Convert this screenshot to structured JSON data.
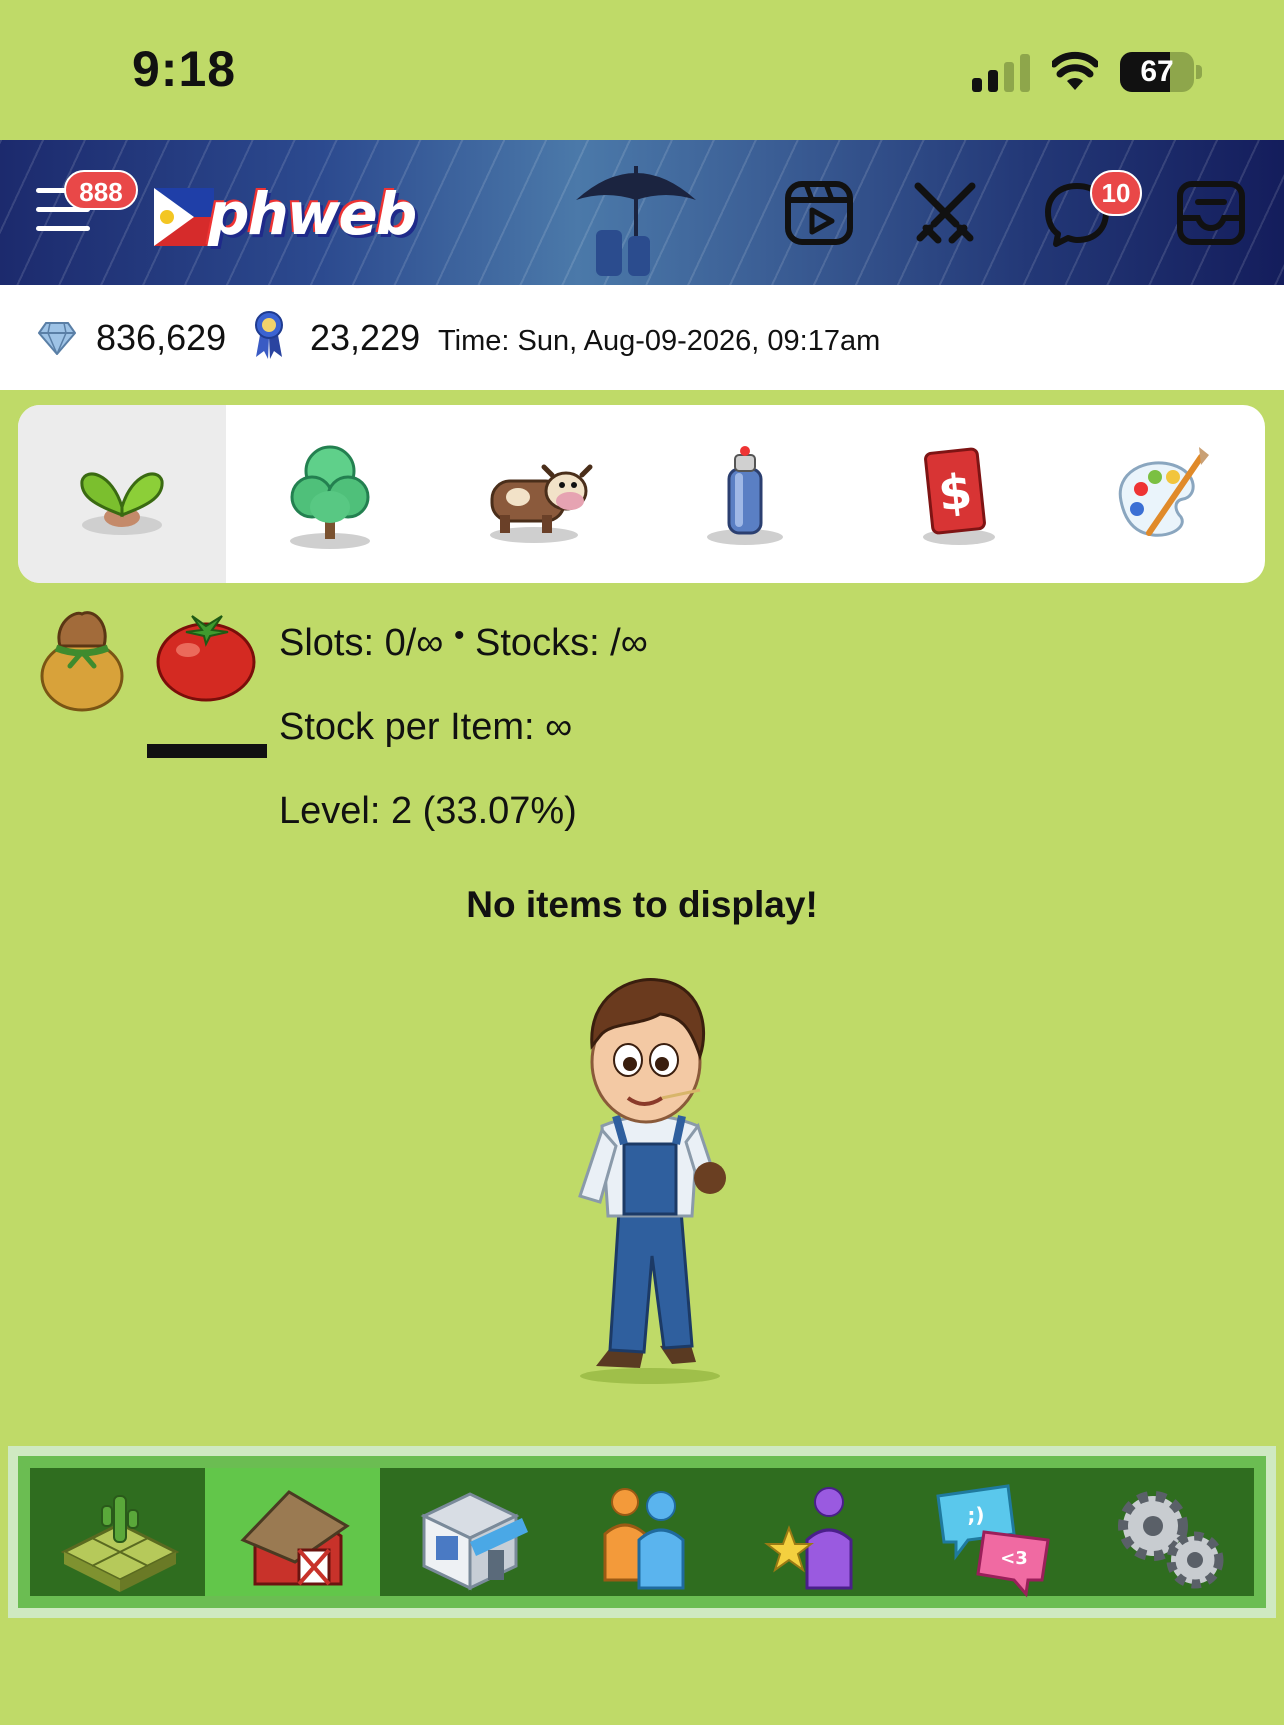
{
  "status_bar": {
    "time": "9:18",
    "battery": "67",
    "battery_level": 0.67,
    "icons": [
      "signal-icon",
      "wifi-icon",
      "battery-icon"
    ]
  },
  "header": {
    "menu_badge": "888",
    "logo_text": "phweb",
    "icons": [
      "menu-icon",
      "video-icon",
      "battle-icon",
      "chat-icon",
      "inbox-icon"
    ],
    "chat_badge": "10"
  },
  "currency": {
    "gems": "836,629",
    "ribbons": "23,229",
    "time_label": "Time: Sun, Aug-09-2026, 09:17am"
  },
  "category_tabs": {
    "active_index": 0,
    "icons": [
      "sprout-icon",
      "tree-icon",
      "cow-icon",
      "spray-can-icon",
      "dollar-card-icon",
      "paint-palette-icon"
    ]
  },
  "info": {
    "slots": "Slots: 0/∞",
    "separator": "•",
    "stocks": "Stocks: /∞",
    "stock_per_item": "Stock per Item: ∞",
    "level": "Level: 2 (33.07%)"
  },
  "empty_message": "No items to display!",
  "bottom_nav": {
    "active_index": 1,
    "icons": [
      "farm-plot-icon",
      "barn-icon",
      "shop-icon",
      "friends-icon",
      "achievements-icon",
      "chat-bubbles-icon",
      "settings-gears-icon"
    ]
  },
  "colors": {
    "page_bg": "#bfda68",
    "nav_dark": "#2f6d1f",
    "nav_active": "#62c64a",
    "badge_red": "#e94848"
  }
}
